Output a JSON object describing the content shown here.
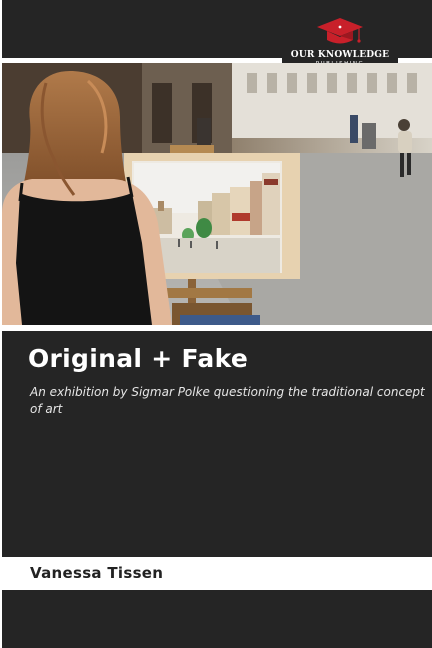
{
  "publisher": {
    "name_line1": "OUR KNOWLEDGE",
    "name_line2": "PUBLISHING",
    "logo_icon": "graduation-cap-icon",
    "accent_color": "#c8202a"
  },
  "book": {
    "title": "Original + Fake",
    "subtitle": "An exhibition by Sigmar Polke questioning the traditional concept of art",
    "author": "Vanessa Tissen"
  },
  "colors": {
    "dark_band": "#252525",
    "background": "#ffffff"
  }
}
